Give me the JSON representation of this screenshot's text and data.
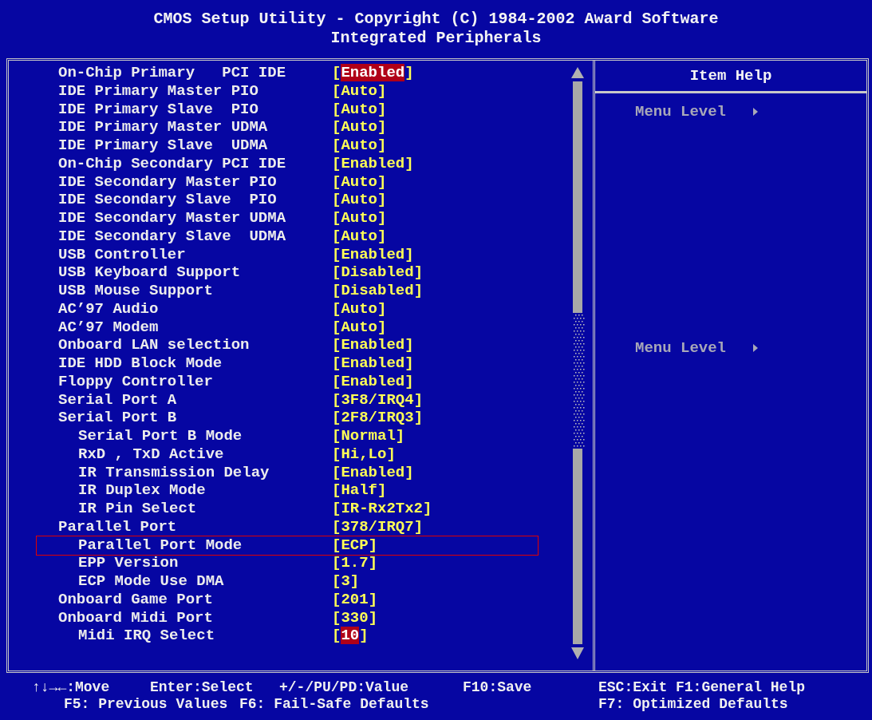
{
  "header": {
    "title": "CMOS Setup Utility - Copyright (C) 1984-2002 Award Software",
    "subtitle": "Integrated Peripherals"
  },
  "items": [
    {
      "label": "On-Chip Primary   PCI IDE",
      "value": "[Enabled]",
      "selected": true
    },
    {
      "label": "IDE Primary Master PIO",
      "value": "[Auto]",
      "selected": false
    },
    {
      "label": "IDE Primary Slave  PIO",
      "value": "[Auto]",
      "selected": false
    },
    {
      "label": "IDE Primary Master UDMA",
      "value": "[Auto]",
      "selected": false
    },
    {
      "label": "IDE Primary Slave  UDMA",
      "value": "[Auto]",
      "selected": false
    },
    {
      "label": "On-Chip Secondary PCI IDE",
      "value": "[Enabled]",
      "selected": false
    },
    {
      "label": "IDE Secondary Master PIO",
      "value": "[Auto]",
      "selected": false
    },
    {
      "label": "IDE Secondary Slave  PIO",
      "value": "[Auto]",
      "selected": false
    },
    {
      "label": "IDE Secondary Master UDMA",
      "value": "[Auto]",
      "selected": false
    },
    {
      "label": "IDE Secondary Slave  UDMA",
      "value": "[Auto]",
      "selected": false
    },
    {
      "label": "USB Controller",
      "value": "[Enabled]",
      "selected": false
    },
    {
      "label": "USB Keyboard Support",
      "value": "[Disabled]",
      "selected": false
    },
    {
      "label": "USB Mouse Support",
      "value": "[Disabled]",
      "selected": false
    },
    {
      "label": "AC’97 Audio",
      "value": "[Auto]",
      "selected": false
    },
    {
      "label": "AC’97 Modem",
      "value": "[Auto]",
      "selected": false
    },
    {
      "label": "Onboard LAN selection",
      "value": "[Enabled]",
      "selected": false
    },
    {
      "label": "IDE HDD Block Mode",
      "value": "[Enabled]",
      "selected": false
    },
    {
      "label": "Floppy Controller",
      "value": "[Enabled]",
      "selected": false
    },
    {
      "label": "Serial Port A",
      "value": "[3F8/IRQ4]",
      "selected": false
    },
    {
      "label": "Serial Port B",
      "value": "[2F8/IRQ3]",
      "selected": false,
      "children": [
        {
          "label": "Serial Port B Mode",
          "value": "[Normal]",
          "selected": false
        },
        {
          "label": "RxD , TxD Active",
          "value": "[Hi,Lo]",
          "selected": false
        },
        {
          "label": "IR Transmission Delay",
          "value": "[Enabled]",
          "selected": false
        },
        {
          "label": "IR Duplex Mode",
          "value": "[Half]",
          "selected": false
        },
        {
          "label": "IR Pin Select",
          "value": "[IR-Rx2Tx2]",
          "selected": false
        }
      ]
    },
    {
      "label": "Parallel Port",
      "value": "[378/IRQ7]",
      "selected": false,
      "children": [
        {
          "label": "Parallel Port Mode",
          "value": "[ECP]",
          "selected": false,
          "outlined": true
        },
        {
          "label": "EPP Version",
          "value": "[1.7]",
          "selected": false
        },
        {
          "label": "ECP Mode Use DMA",
          "value": "[3]",
          "selected": false
        }
      ]
    },
    {
      "label": "Onboard Game Port",
      "value": "[201]",
      "selected": false
    },
    {
      "label": "Onboard Midi Port",
      "value": "[330]",
      "selected": false,
      "children": [
        {
          "label": "Midi IRQ Select",
          "value": "[10]",
          "selected": true
        }
      ]
    }
  ],
  "help": {
    "title": "Item Help",
    "lines": [
      "Menu Level",
      "Menu Level"
    ]
  },
  "footer": [
    [
      "↑↓→←:Move",
      "Enter:Select",
      "+/-/PU/PD:Value",
      "F10:Save",
      "ESC:Exit",
      "F1:General Help"
    ],
    [
      "F5: Previous Values",
      "F6: Fail-Safe Defaults",
      "F7: Optimized Defaults"
    ]
  ]
}
